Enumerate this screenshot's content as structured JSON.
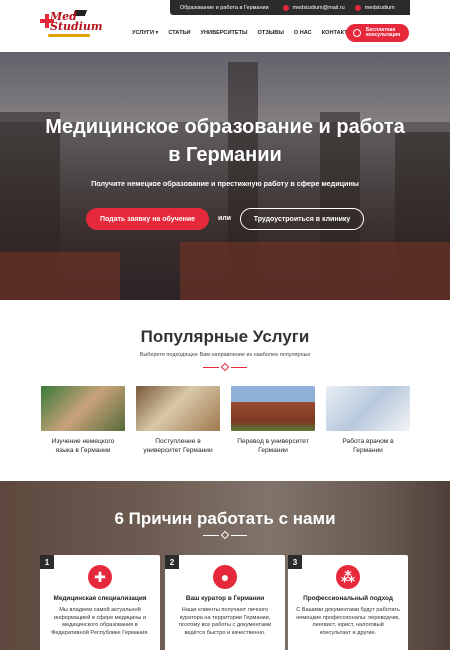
{
  "topbar": {
    "tagline": "Образование и работа в Германии",
    "email": "medstudium@mail.ru",
    "social": "medstudium",
    "email_icon": "mail-icon",
    "social_icon": "instagram-icon"
  },
  "logo": {
    "line1": "Med",
    "line2": "Studium"
  },
  "nav": {
    "items": [
      "Услуги ▾",
      "Статьи",
      "Университеты",
      "Отзывы",
      "О нас",
      "Контакты"
    ]
  },
  "cta_top": {
    "line1": "Бесплатная",
    "line2": "консультация"
  },
  "hero": {
    "title_line1": "Медицинское образование и работа",
    "title_line2": "в Германии",
    "subtitle": "Получите немецкое образование и престижную работу в сфере медицины",
    "primary_button": "Подать заявку на обучение",
    "or_text": "или",
    "secondary_button": "Трудоустроиться в клинику"
  },
  "services": {
    "title": "Популярные Услуги",
    "subtitle": "Выберете подходящее Вам направление из наиболее популярных",
    "items": [
      {
        "line1": "Изучение немецкого",
        "line2": "языка в Германии"
      },
      {
        "line1": "Поступление в",
        "line2": "университет Германии"
      },
      {
        "line1": "Перевод в университет",
        "line2": "Германии"
      },
      {
        "line1": "Работа врачом в",
        "line2": "Германии"
      }
    ]
  },
  "reasons": {
    "title": "6 Причин работать с нами",
    "cards": [
      {
        "num": "1",
        "icon": "medical-cross-icon",
        "title": "Медицинская специализация",
        "text": "Мы владеем самой актуальной информацией в сфере медицины и медицинского образования в Федеративной Республике Германия."
      },
      {
        "num": "2",
        "icon": "curator-person-icon",
        "title": "Ваш куратор в Германии",
        "text": "Наши клиенты получают личного куратора на территории Германии, поэтому все работы с документами ведётся быстро и качественно."
      },
      {
        "num": "3",
        "icon": "team-icon",
        "title": "Профессиональный подход",
        "text": "С Вашими документами будут работать немецкие профессионалы: переводчик, лингвист, юрист, налоговый консультант и другие."
      }
    ]
  },
  "colors": {
    "accent": "#e5293b",
    "dark": "#2b2b2b"
  }
}
